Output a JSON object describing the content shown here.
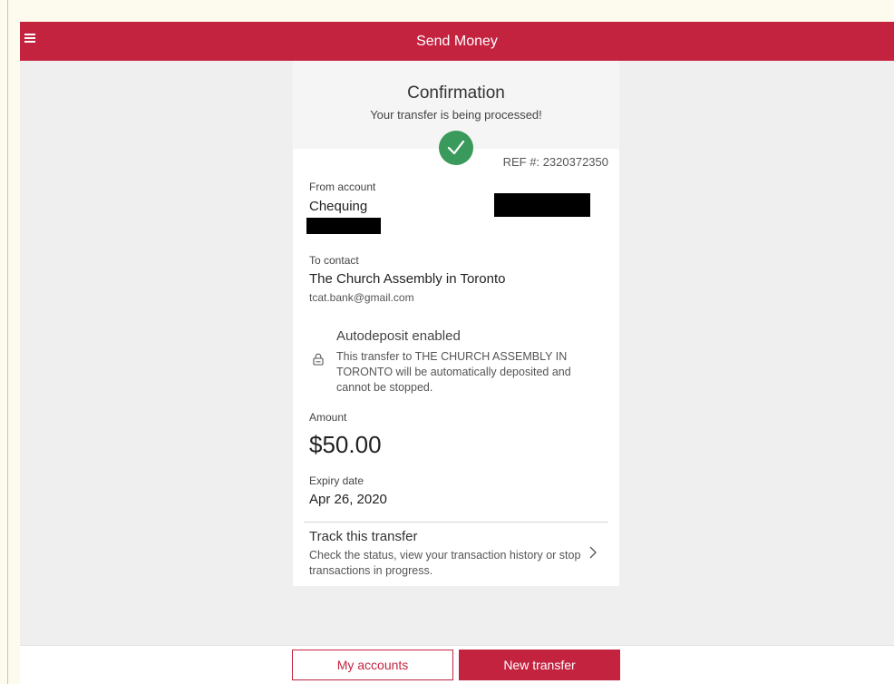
{
  "header": {
    "title": "Send Money",
    "menu_icon": "hamburger-menu-icon",
    "color": "#c42340"
  },
  "confirmation": {
    "title": "Confirmation",
    "subtitle": "Your transfer is being processed!",
    "status_icon": "checkmark-icon",
    "status_color": "#3a9a5b",
    "ref": "REF #: 2320372350"
  },
  "from": {
    "label": "From account",
    "account": "Chequing"
  },
  "to": {
    "label": "To contact",
    "name": "The Church Assembly in Toronto",
    "email": "tcat.bank@gmail.com"
  },
  "autodeposit": {
    "icon": "lock-icon",
    "title": "Autodeposit enabled",
    "description": "This transfer to THE CHURCH ASSEMBLY IN TORONTO will be automatically deposited and cannot be stopped."
  },
  "amount": {
    "label": "Amount",
    "value": "$50.00"
  },
  "expiry": {
    "label": "Expiry date",
    "value": "Apr 26, 2020"
  },
  "track": {
    "title": "Track this transfer",
    "description": "Check the status, view your transaction history or stop transactions in progress.",
    "icon": "chevron-right-icon"
  },
  "footer": {
    "my_accounts": "My accounts",
    "new_transfer": "New transfer"
  }
}
